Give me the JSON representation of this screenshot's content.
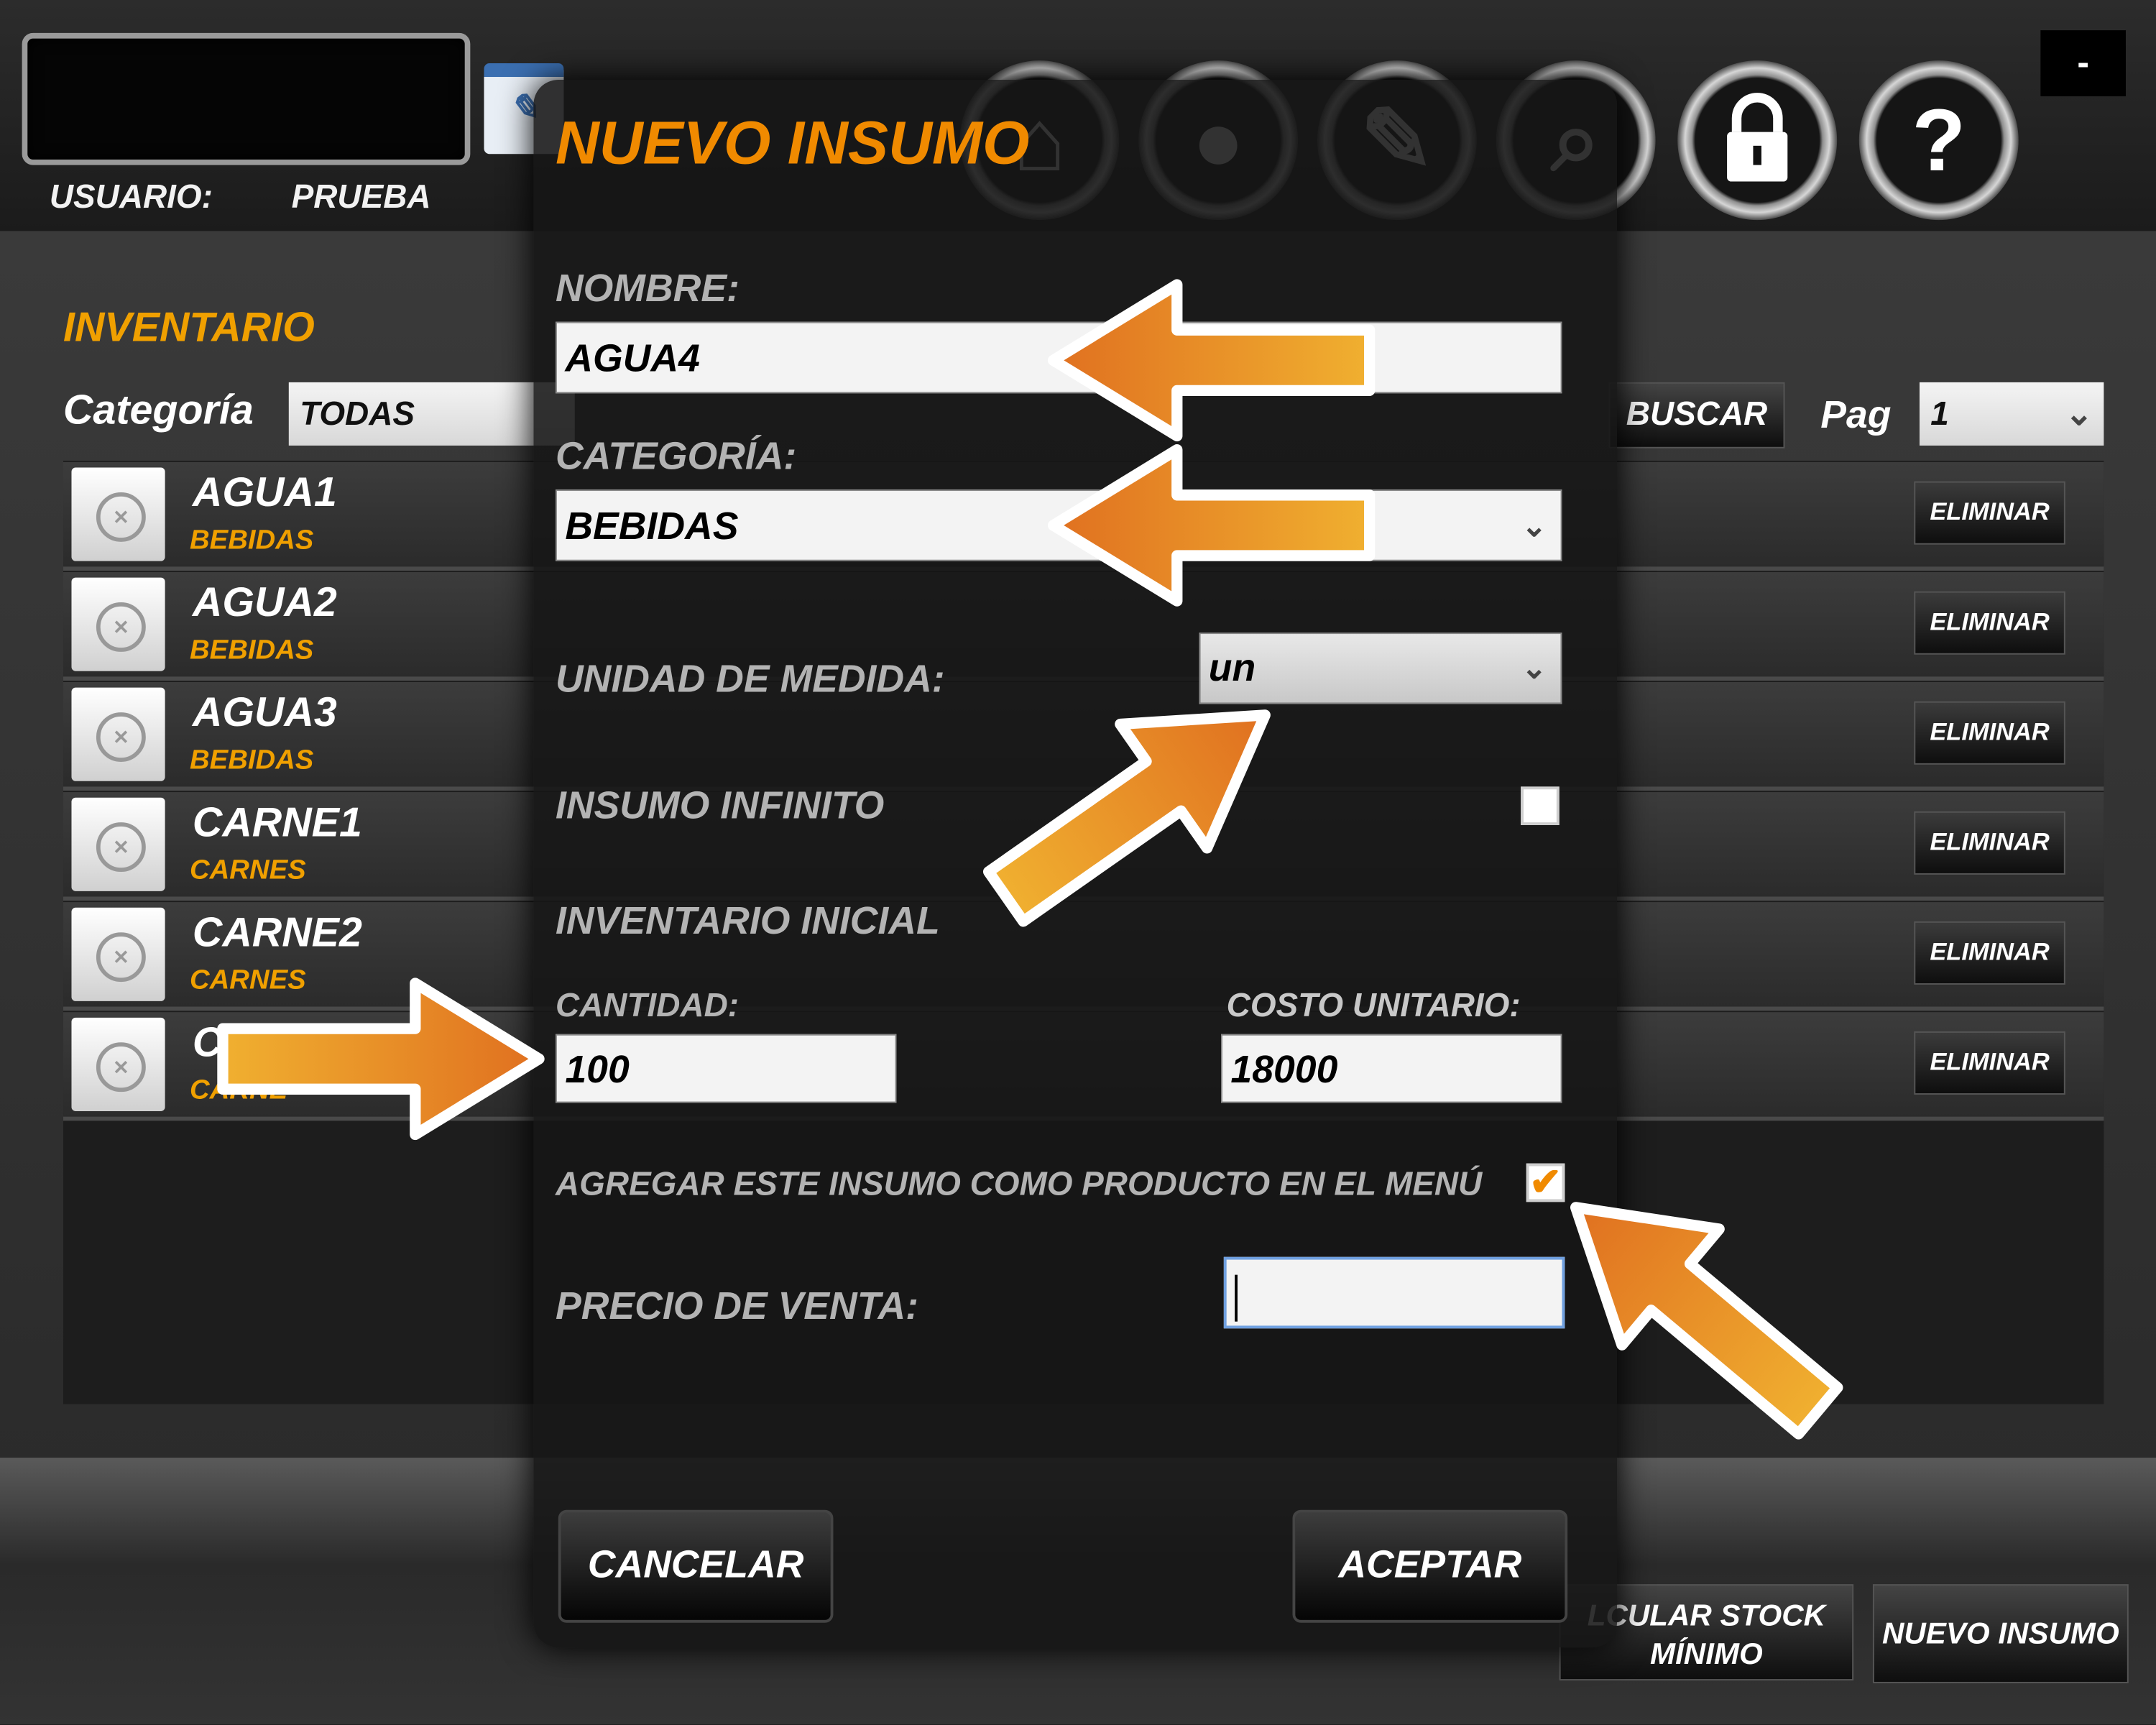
{
  "header": {
    "user_label": "USUARIO:",
    "user_name": "PRUEBA",
    "minimize_label": "-",
    "nav_icons": [
      "home-icon",
      "users-icon",
      "notepad-icon",
      "search-icon",
      "lock-icon",
      "help-icon"
    ]
  },
  "inventory": {
    "title": "INVENTARIO",
    "category_label": "Categoría",
    "category_value": "TODAS",
    "search_button": "BUSCAR",
    "page_label": "Pag",
    "page_value": "1",
    "delete_label": "ELIMINAR",
    "items": [
      {
        "name": "AGUA1",
        "category": "BEBIDAS"
      },
      {
        "name": "AGUA2",
        "category": "BEBIDAS"
      },
      {
        "name": "AGUA3",
        "category": "BEBIDAS"
      },
      {
        "name": "CARNE1",
        "category": "CARNES"
      },
      {
        "name": "CARNE2",
        "category": "CARNES"
      },
      {
        "name": "CARN",
        "category": "CARNE"
      }
    ],
    "bottom_buttons": {
      "calc_stock": "LCULAR STOCK MÍNIMO",
      "new_item": "NUEVO INSUMO"
    }
  },
  "modal": {
    "title": "NUEVO INSUMO",
    "name_label": "NOMBRE:",
    "name_value": "AGUA4",
    "category_label": "CATEGORÍA:",
    "category_value": "BEBIDAS",
    "unit_label": "UNIDAD DE MEDIDA:",
    "unit_value": "un",
    "infinite_label": "INSUMO INFINITO",
    "initial_inventory_label": "INVENTARIO INICIAL",
    "quantity_label": "CANTIDAD:",
    "quantity_value": "100",
    "unit_cost_label": "COSTO UNITARIO:",
    "unit_cost_value": "18000",
    "add_to_menu_label": "AGREGAR ESTE INSUMO COMO PRODUCTO EN EL MENÚ",
    "add_to_menu_checked": true,
    "sale_price_label": "PRECIO DE VENTA:",
    "sale_price_value": "",
    "cancel_button": "CANCELAR",
    "accept_button": "ACEPTAR",
    "checkmark_glyph": "✔"
  },
  "colors": {
    "accent": "#f08a00",
    "arrow_dark": "#e07020",
    "arrow_light": "#f0b030"
  }
}
